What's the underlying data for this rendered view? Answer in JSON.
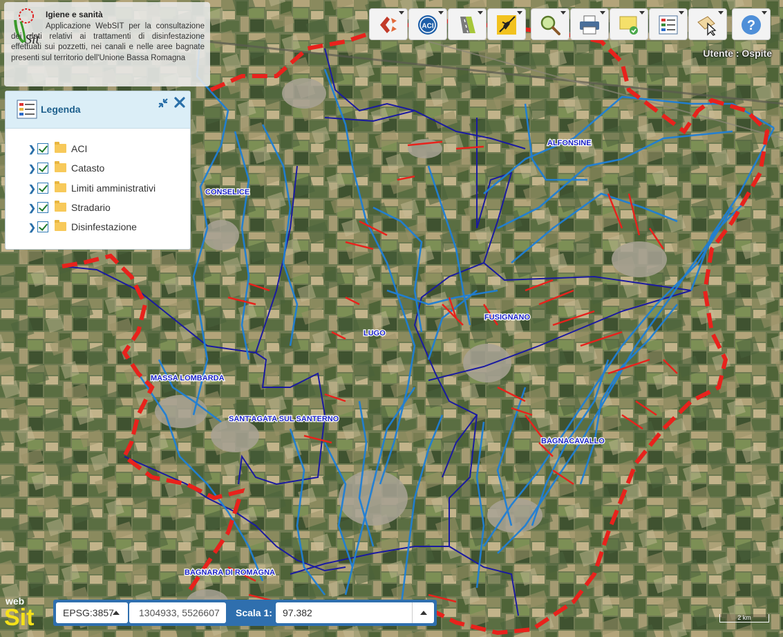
{
  "app": {
    "title": "Igiene e sanità",
    "description": "Applicazione WebSIT per la consultazione dei dati relativi ai trattamenti di disinfestazione effettuati sui pozzetti, nei canali e nelle aree bagnate presenti sul territorio dell'Unione Bassa Romagna"
  },
  "toolbar": {
    "buttons": [
      {
        "name": "catasto-tool",
        "icon": "red-arrows-icon"
      },
      {
        "name": "aci-tool",
        "icon": "aci-logo-icon"
      },
      {
        "name": "road-tool",
        "icon": "road-icon"
      },
      {
        "name": "mosquito-tool",
        "icon": "mosquito-icon"
      },
      {
        "name": "search-tool",
        "icon": "magnifier-icon"
      },
      {
        "name": "print-tool",
        "icon": "printer-icon"
      },
      {
        "name": "comment-tool",
        "icon": "note-icon"
      },
      {
        "name": "legend-tool",
        "icon": "legend-icon"
      },
      {
        "name": "info-tool",
        "icon": "pointer-card-icon"
      },
      {
        "name": "help-tool",
        "icon": "question-icon"
      }
    ]
  },
  "user": {
    "label": "Utente : Ospite"
  },
  "legend": {
    "title": "Legenda",
    "layers": [
      {
        "label": "ACI",
        "checked": true
      },
      {
        "label": "Catasto",
        "checked": true
      },
      {
        "label": "Limiti amministrativi",
        "checked": true
      },
      {
        "label": "Stradario",
        "checked": true
      },
      {
        "label": "Disinfestazione",
        "checked": true
      }
    ]
  },
  "map": {
    "towns": [
      {
        "name": "ALFONSINE"
      },
      {
        "name": "CONSELICE"
      },
      {
        "name": "FUSIGNANO"
      },
      {
        "name": "LUGO"
      },
      {
        "name": "MASSA LOMBARDA"
      },
      {
        "name": "SANT'AGATA SUL SANTERNO"
      },
      {
        "name": "BAGNACAVALLO"
      },
      {
        "name": "BAGNARA DI ROMAGNA"
      }
    ],
    "colors": {
      "canal": "#1f7fd6",
      "boundary": "#1a1aa0",
      "treatment": "#e8221c"
    }
  },
  "statusbar": {
    "logo_top": "web",
    "logo_bottom": "Sit",
    "projection": "EPSG:3857",
    "coordinates": "1304933, 5526607",
    "scale_label": "Scala 1:",
    "scale_value": "97.382",
    "scalebar_label": "2 km"
  }
}
